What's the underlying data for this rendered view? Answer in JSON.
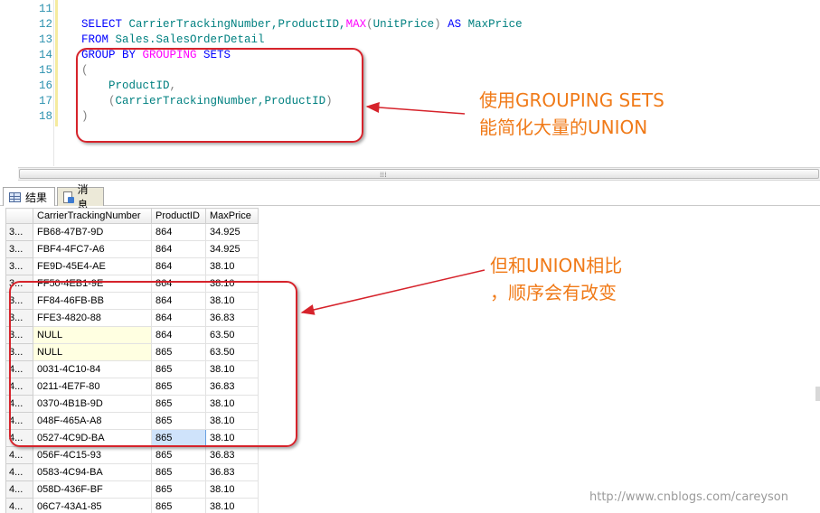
{
  "editor": {
    "line_numbers": [
      "11",
      "12",
      "13",
      "14",
      "15",
      "16",
      "17",
      "18"
    ],
    "line12": {
      "select": "SELECT",
      "cols": " CarrierTrackingNumber,ProductID,",
      "max": "MAX",
      "open": "(",
      "arg": "UnitPrice",
      "close": ")",
      "as": " AS",
      "alias": " MaxPrice"
    },
    "line13": {
      "from": "FROM",
      "table": " Sales.SalesOrderDetail"
    },
    "line14": {
      "group_by": "GROUP BY",
      "grouping": " GROUPING",
      "sets": " SETS"
    },
    "line15": {
      "paren": "("
    },
    "line16": {
      "indent": "    ",
      "col": "ProductID",
      "comma": ","
    },
    "line17": {
      "indent": "    ",
      "open": "(",
      "cols": "CarrierTrackingNumber,ProductID",
      "close": ")"
    },
    "line18": {
      "paren": ")"
    }
  },
  "tabs": {
    "results_label": "结果",
    "messages_label": "消息"
  },
  "grid": {
    "columns": [
      "",
      "CarrierTrackingNumber",
      "ProductID",
      "MaxPrice"
    ],
    "rows": [
      {
        "n": "3...",
        "ctn": "FB68-47B7-9D",
        "pid": "864",
        "max": "34.925"
      },
      {
        "n": "3...",
        "ctn": "FBF4-4FC7-A6",
        "pid": "864",
        "max": "34.925"
      },
      {
        "n": "3...",
        "ctn": "FE9D-45E4-AE",
        "pid": "864",
        "max": "38.10"
      },
      {
        "n": "3...",
        "ctn": "FF50-4EB1-9E",
        "pid": "864",
        "max": "38.10"
      },
      {
        "n": "3...",
        "ctn": "FF84-46FB-BB",
        "pid": "864",
        "max": "38.10"
      },
      {
        "n": "3...",
        "ctn": "FFE3-4820-88",
        "pid": "864",
        "max": "36.83"
      },
      {
        "n": "3...",
        "ctn": "NULL",
        "pid": "864",
        "max": "63.50"
      },
      {
        "n": "3...",
        "ctn": "NULL",
        "pid": "865",
        "max": "63.50"
      },
      {
        "n": "4...",
        "ctn": "0031-4C10-84",
        "pid": "865",
        "max": "38.10"
      },
      {
        "n": "4...",
        "ctn": "0211-4E7F-80",
        "pid": "865",
        "max": "36.83"
      },
      {
        "n": "4...",
        "ctn": "0370-4B1B-9D",
        "pid": "865",
        "max": "38.10"
      },
      {
        "n": "4...",
        "ctn": "048F-465A-A8",
        "pid": "865",
        "max": "38.10"
      },
      {
        "n": "4...",
        "ctn": "0527-4C9D-BA",
        "pid": "865",
        "max": "38.10"
      },
      {
        "n": "4...",
        "ctn": "056F-4C15-93",
        "pid": "865",
        "max": "36.83"
      },
      {
        "n": "4...",
        "ctn": "0583-4C94-BA",
        "pid": "865",
        "max": "36.83"
      },
      {
        "n": "4...",
        "ctn": "058D-436F-BF",
        "pid": "865",
        "max": "38.10"
      },
      {
        "n": "4...",
        "ctn": "06C7-43A1-85",
        "pid": "865",
        "max": "38.10"
      }
    ]
  },
  "annotations": {
    "note1_line1": "使用GROUPING SETS",
    "note1_line2": "能简化大量的UNION",
    "note2_line1": "但和UNION相比",
    "note2_line2": "，顺序会有改变",
    "color": "#f07a18",
    "box_color": "#d6232b"
  },
  "watermark": "http://www.cnblogs.com/careyson"
}
